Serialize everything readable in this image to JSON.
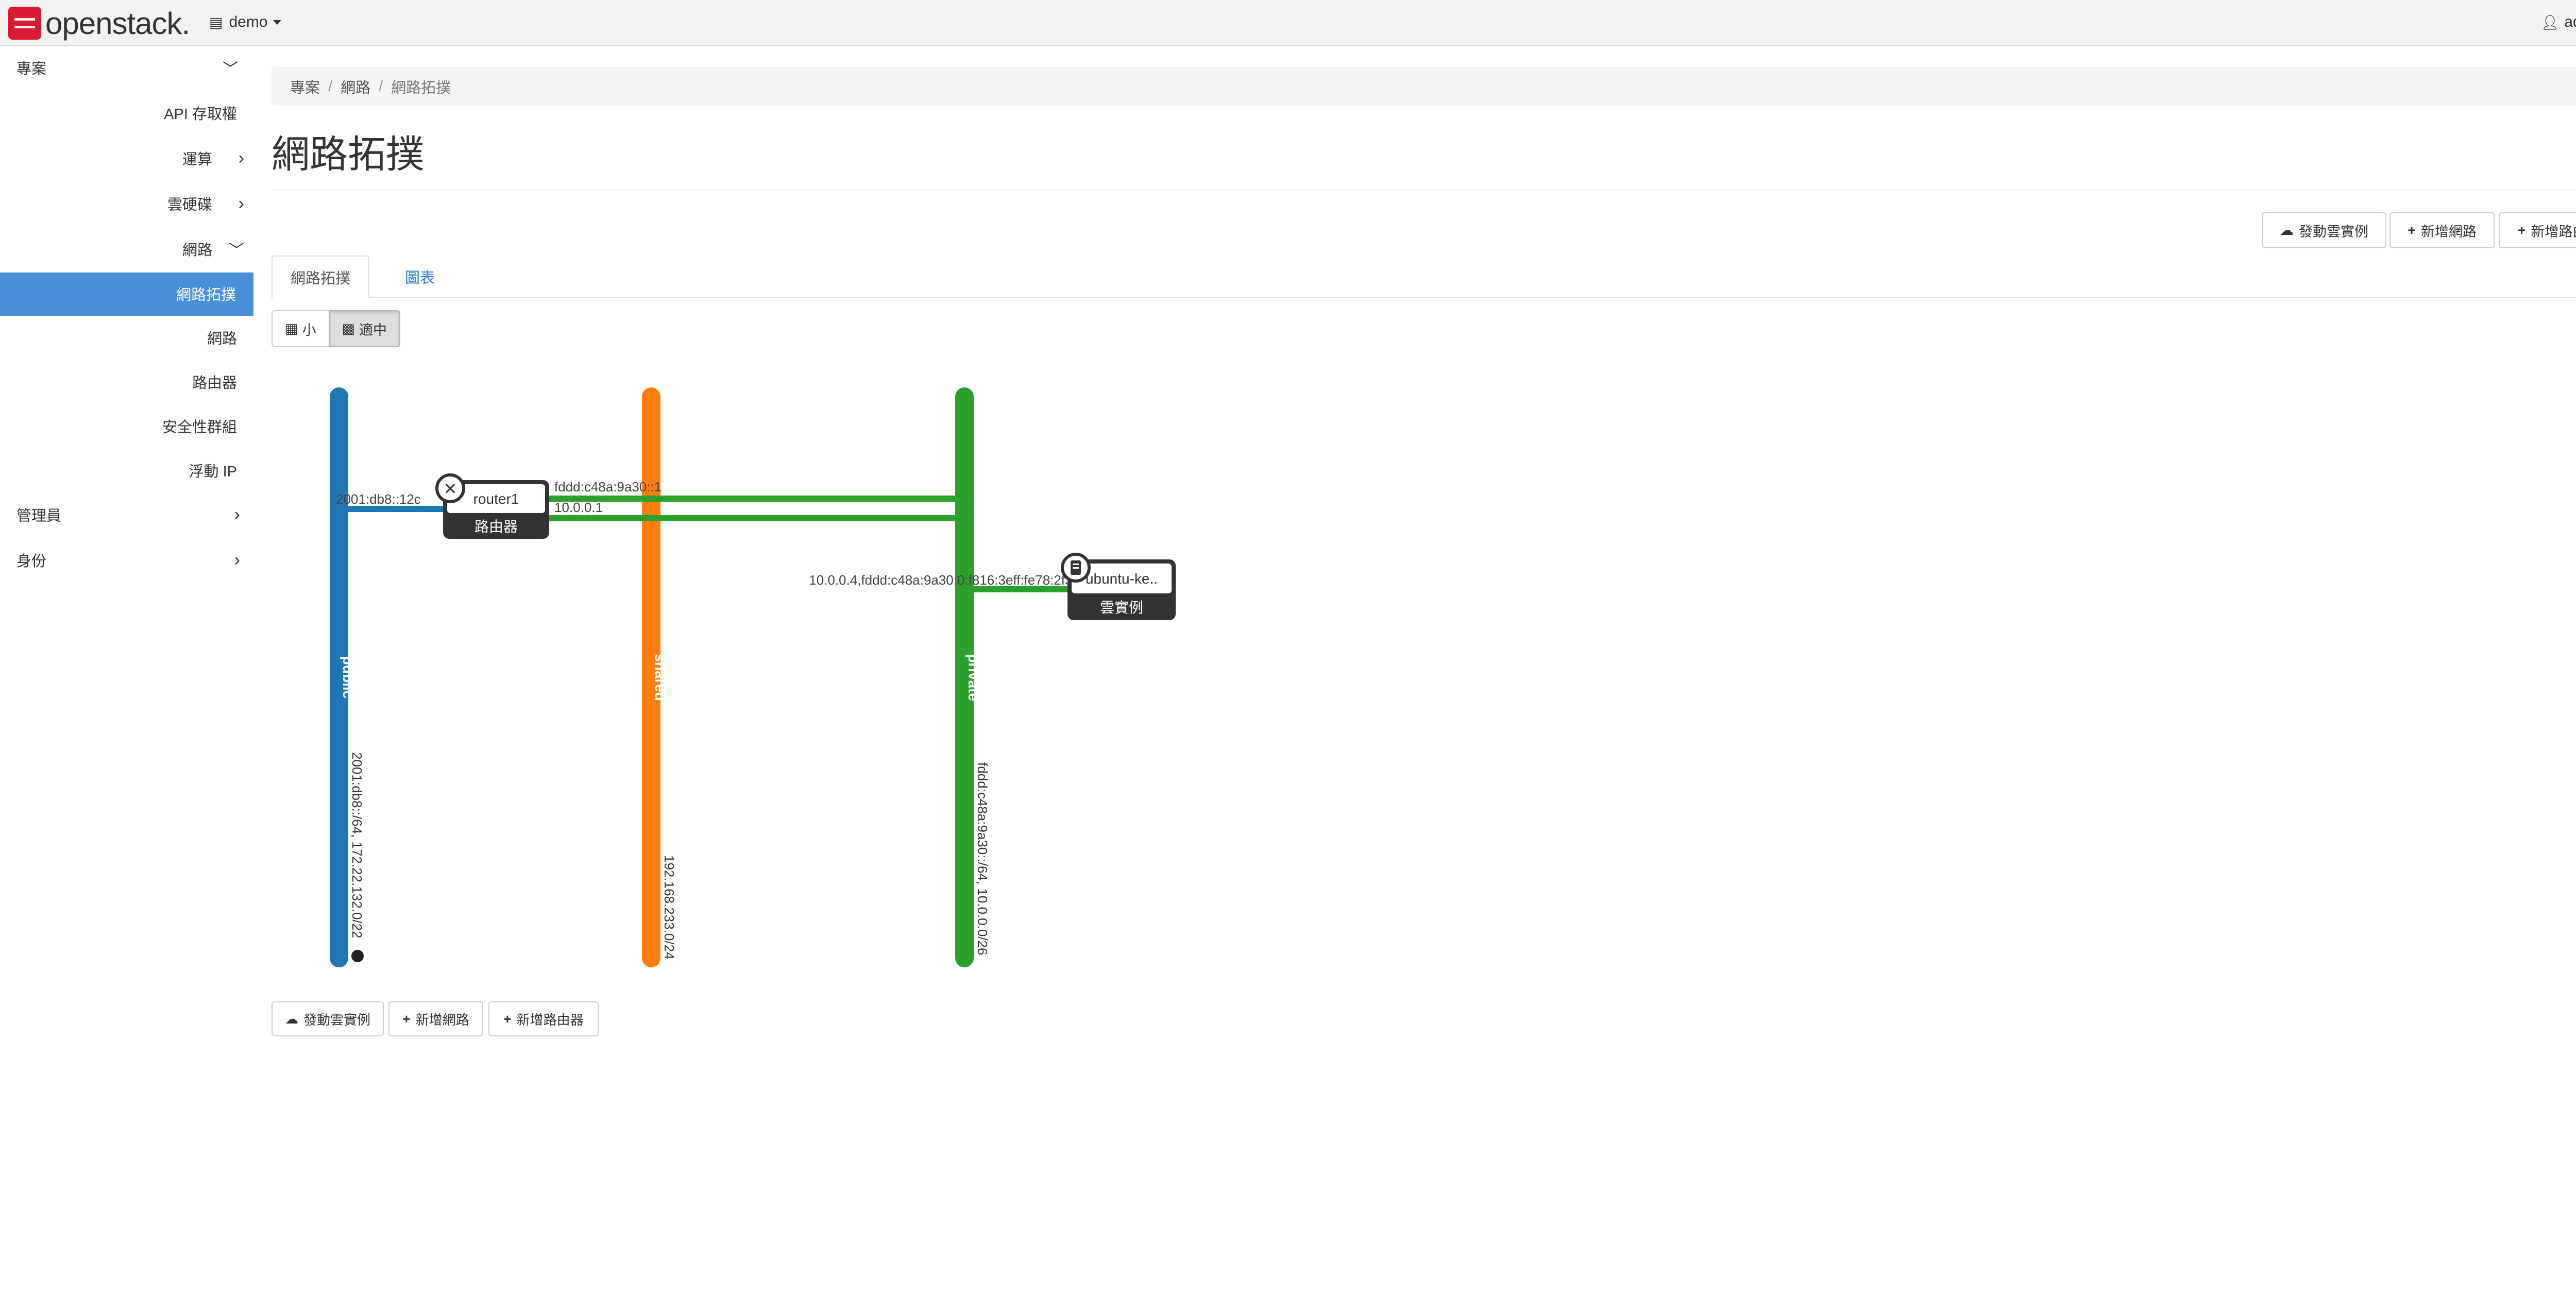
{
  "navbar": {
    "brand": "openstack.",
    "project": "demo",
    "user": "admin"
  },
  "sidebar": {
    "project_label": "專案",
    "api_access": "API 存取權",
    "compute": "運算",
    "volumes": "雲硬碟",
    "network": "網路",
    "net_topology": "網路拓撲",
    "networks": "網路",
    "routers": "路由器",
    "security_groups": "安全性群組",
    "floating_ips": "浮動 IP",
    "admin": "管理員",
    "identity": "身份"
  },
  "breadcrumb": [
    "專案",
    "網路",
    "網路拓撲"
  ],
  "page": {
    "title": "網路拓撲"
  },
  "actions": {
    "launch_instance": "發動雲實例",
    "create_network": "新增網路",
    "create_router": "新增路由器"
  },
  "tabs": {
    "topology": "網路拓撲",
    "graph": "圖表"
  },
  "view_toggle": {
    "small": "小",
    "normal": "適中"
  },
  "topology": {
    "networks": [
      {
        "name": "public",
        "color": "#1f77b4",
        "cidr": "2001:db8::/64, 172.22.132.0/22"
      },
      {
        "name": "shared",
        "color": "#ff7f0e",
        "cidr": "192.168.233.0/24"
      },
      {
        "name": "private",
        "color": "#2ca02c",
        "cidr": "fddd:c48a:9a30::/64, 10.0.0.0/26"
      }
    ],
    "router": {
      "name": "router1",
      "type": "路由器"
    },
    "router_ips": {
      "public": "2001:db8::12c",
      "private_v6": "fddd:c48a:9a30::1",
      "private_v4": "10.0.0.1"
    },
    "instance": {
      "name": "ubuntu-ke..",
      "type": "雲實例",
      "ips": "10.0.0.4,fddd:c48a:9a30:0:f816:3eff:fe78:2f32"
    }
  }
}
